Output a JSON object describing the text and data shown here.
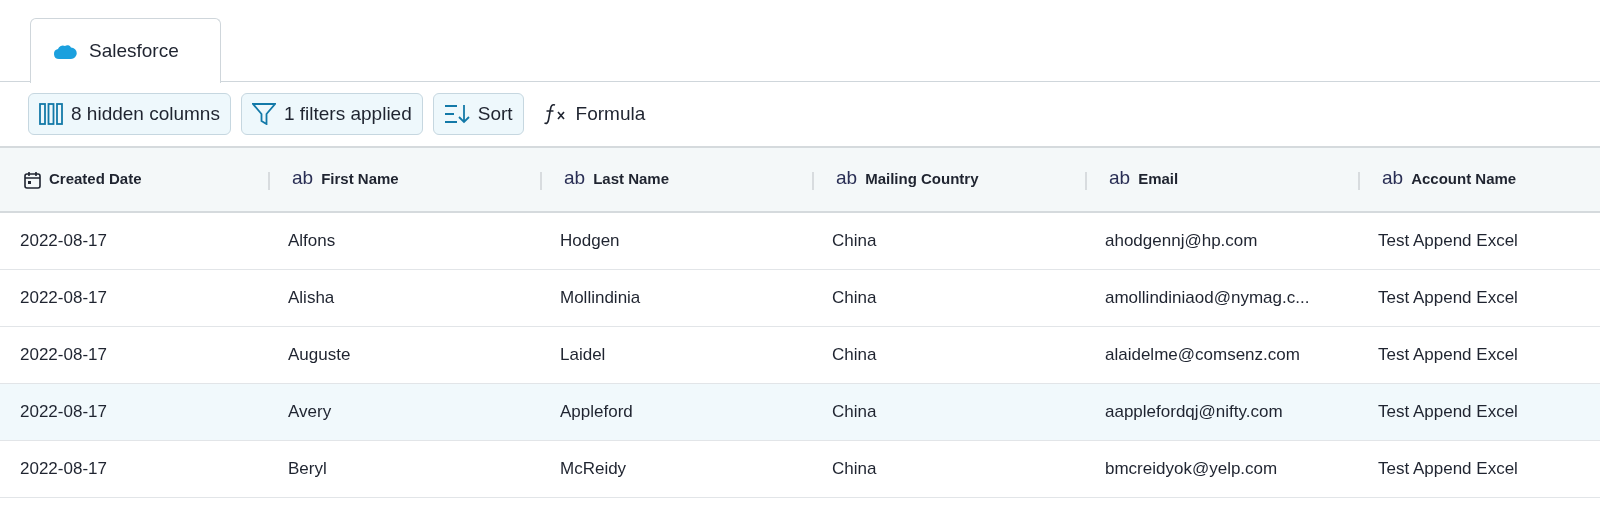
{
  "tabs": [
    {
      "label": "Salesforce",
      "selected": true
    }
  ],
  "toolbar": [
    {
      "kind": "columns",
      "label": "8 hidden columns"
    },
    {
      "kind": "filter",
      "label": "1 filters applied"
    },
    {
      "kind": "sort",
      "label": "Sort"
    },
    {
      "kind": "formula",
      "label": "Formula"
    }
  ],
  "table": {
    "columns": [
      {
        "kind": "date",
        "label": "Created Date"
      },
      {
        "kind": "text",
        "glyph": "ab",
        "label": "First Name"
      },
      {
        "kind": "text",
        "glyph": "ab",
        "label": "Last Name"
      },
      {
        "kind": "text",
        "glyph": "ab",
        "label": "Mailing Country"
      },
      {
        "kind": "text",
        "glyph": "ab",
        "label": "Email"
      },
      {
        "kind": "text",
        "glyph": "ab",
        "label": "Account Name"
      }
    ],
    "rows": [
      {
        "selected": false,
        "cells": [
          "2022-08-17",
          "Alfons",
          "Hodgen",
          "China",
          "ahodgennj@hp.com",
          "Test Append Excel"
        ]
      },
      {
        "selected": false,
        "cells": [
          "2022-08-17",
          "Alisha",
          "Mollindinia",
          "China",
          "amollindiniaod@nymag.c...",
          "Test Append Excel"
        ]
      },
      {
        "selected": false,
        "cells": [
          "2022-08-17",
          "Auguste",
          "Laidel",
          "China",
          "alaidelme@comsenz.com",
          "Test Append Excel"
        ]
      },
      {
        "selected": true,
        "cells": [
          "2022-08-17",
          "Avery",
          "Appleford",
          "China",
          "aapplefordqj@nifty.com",
          "Test Append Excel"
        ]
      },
      {
        "selected": false,
        "cells": [
          "2022-08-17",
          "Beryl",
          "McReidy",
          "China",
          "bmcreidyok@yelp.com",
          "Test Append Excel"
        ]
      }
    ]
  }
}
